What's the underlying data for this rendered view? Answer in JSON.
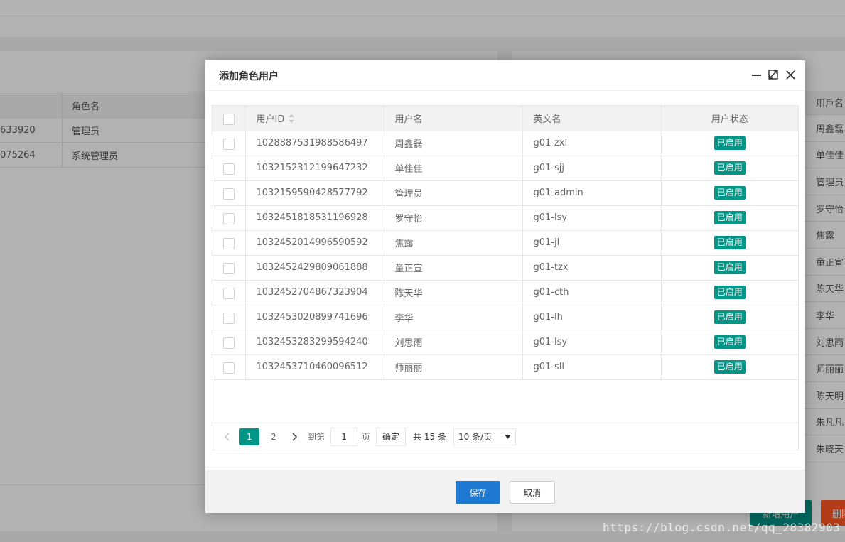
{
  "background": {
    "left_table": {
      "header": "角色名",
      "rows": [
        {
          "id_tail": "633920",
          "name": "管理员"
        },
        {
          "id_tail": "075264",
          "name": "系统管理员"
        }
      ]
    },
    "right_table": {
      "header": "用戶名",
      "rows": [
        "周鑫磊",
        "单佳佳",
        "管理员",
        "罗守怡",
        "焦露",
        "童正宣",
        "陈天华",
        "李华",
        "刘思雨",
        "师丽丽",
        "陈天明",
        "朱凡凡",
        "朱晓天"
      ]
    },
    "add_user_button": "新增用户",
    "delete_button": "删除"
  },
  "watermark": "https://blog.csdn.net/qq_28382903",
  "modal": {
    "title": "添加角色用户",
    "columns": {
      "user_id": "用户ID",
      "username": "用户名",
      "english_name": "英文名",
      "status": "用户状态"
    },
    "rows": [
      {
        "id": "1028887531988586497",
        "name": "周鑫磊",
        "en": "g01-zxl",
        "status": "已启用"
      },
      {
        "id": "1032152312199647232",
        "name": "单佳佳",
        "en": "g01-sjj",
        "status": "已启用"
      },
      {
        "id": "1032159590428577792",
        "name": "管理员",
        "en": "g01-admin",
        "status": "已启用"
      },
      {
        "id": "1032451818531196928",
        "name": "罗守怡",
        "en": "g01-lsy",
        "status": "已启用"
      },
      {
        "id": "1032452014996590592",
        "name": "焦露",
        "en": "g01-jl",
        "status": "已启用"
      },
      {
        "id": "1032452429809061888",
        "name": "童正宣",
        "en": "g01-tzx",
        "status": "已启用"
      },
      {
        "id": "1032452704867323904",
        "name": "陈天华",
        "en": "g01-cth",
        "status": "已启用"
      },
      {
        "id": "1032453020899741696",
        "name": "李华",
        "en": "g01-lh",
        "status": "已启用"
      },
      {
        "id": "1032453283299594240",
        "name": "刘思雨",
        "en": "g01-lsy",
        "status": "已启用"
      },
      {
        "id": "1032453710460096512",
        "name": "师丽丽",
        "en": "g01-sll",
        "status": "已启用"
      }
    ],
    "pager": {
      "pages": [
        "1",
        "2"
      ],
      "current": "1",
      "goto_label": "到第",
      "goto_value": "1",
      "page_suffix": "页",
      "confirm": "确定",
      "total": "共 15 条",
      "page_size": "10 条/页"
    },
    "save": "保存",
    "cancel": "取消"
  },
  "colors": {
    "accent": "#009688",
    "primary_button": "#1e79d2",
    "danger": "#ff5722"
  }
}
